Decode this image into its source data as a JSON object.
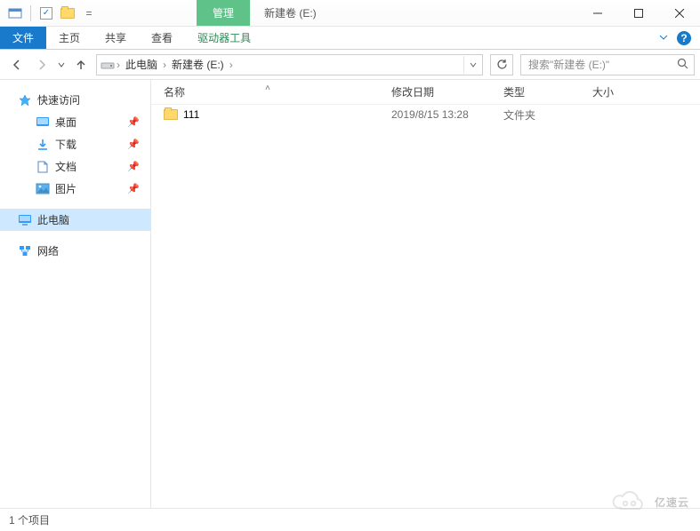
{
  "titlebar": {
    "context_tab": "管理",
    "title": "新建卷 (E:)"
  },
  "ribbon": {
    "file": "文件",
    "home": "主页",
    "share": "共享",
    "view": "查看",
    "drive_tools": "驱动器工具"
  },
  "nav": {
    "breadcrumb": {
      "root": "此电脑",
      "current": "新建卷 (E:)"
    },
    "search_placeholder": "搜索\"新建卷 (E:)\""
  },
  "tree": {
    "quick_access": "快速访问",
    "desktop": "桌面",
    "downloads": "下载",
    "documents": "文档",
    "pictures": "图片",
    "this_pc": "此电脑",
    "network": "网络"
  },
  "columns": {
    "name": "名称",
    "date": "修改日期",
    "type": "类型",
    "size": "大小"
  },
  "rows": [
    {
      "name": "111",
      "date": "2019/8/15 13:28",
      "type": "文件夹",
      "size": ""
    }
  ],
  "status": {
    "count_label": "1 个项目"
  },
  "watermark": "亿速云"
}
